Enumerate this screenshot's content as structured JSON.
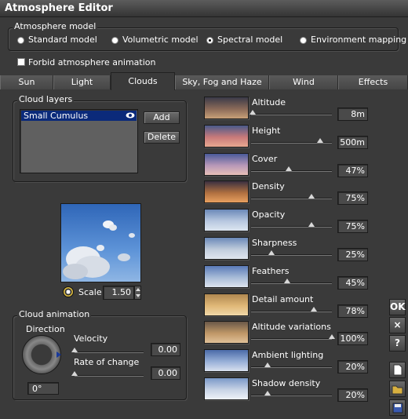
{
  "window": {
    "title": "Atmosphere Editor"
  },
  "atmosphere_model": {
    "title": "Atmosphere model",
    "options": [
      {
        "label": "Standard model",
        "selected": false
      },
      {
        "label": "Volumetric model",
        "selected": false
      },
      {
        "label": "Spectral model",
        "selected": true
      },
      {
        "label": "Environment mapping",
        "selected": false
      }
    ]
  },
  "forbid_animation": {
    "label": "Forbid atmosphere animation",
    "checked": false
  },
  "tabs": [
    {
      "label": "Sun"
    },
    {
      "label": "Light"
    },
    {
      "label": "Clouds",
      "active": true
    },
    {
      "label": "Sky, Fog and Haze"
    },
    {
      "label": "Wind"
    },
    {
      "label": "Effects"
    }
  ],
  "cloud_layers": {
    "title": "Cloud layers",
    "items": [
      "Small Cumulus"
    ],
    "add_label": "Add",
    "delete_label": "Delete"
  },
  "preview": {
    "scale_label": "Scale",
    "scale_value": "1.50"
  },
  "cloud_animation": {
    "title": "Cloud animation",
    "direction_label": "Direction",
    "direction_value": "0°",
    "velocity_label": "Velocity",
    "velocity_value": "0.00",
    "velocity_level": 0,
    "rate_label": "Rate of change",
    "rate_value": "0.00",
    "rate_level": 0
  },
  "params": [
    {
      "label": "Altitude",
      "value": "8m",
      "level": 0.02
    },
    {
      "label": "Height",
      "value": "500m",
      "level": 0.85
    },
    {
      "label": "Cover",
      "value": "47%",
      "level": 0.47
    },
    {
      "label": "Density",
      "value": "75%",
      "level": 0.75
    },
    {
      "label": "Opacity",
      "value": "75%",
      "level": 0.75
    },
    {
      "label": "Sharpness",
      "value": "25%",
      "level": 0.25
    },
    {
      "label": "Feathers",
      "value": "45%",
      "level": 0.45
    },
    {
      "label": "Detail amount",
      "value": "78%",
      "level": 0.78
    },
    {
      "label": "Altitude variations",
      "value": "100%",
      "level": 1.0
    },
    {
      "label": "Ambient lighting",
      "value": "20%",
      "level": 0.2
    },
    {
      "label": "Shadow density",
      "value": "20%",
      "level": 0.2
    }
  ],
  "side_buttons": {
    "ok": "OK",
    "cancel": "×",
    "help": "?"
  },
  "colors": {
    "background": "#3a3a3a",
    "selection": "#0b2a7a",
    "sky": "#4a7fc4"
  }
}
